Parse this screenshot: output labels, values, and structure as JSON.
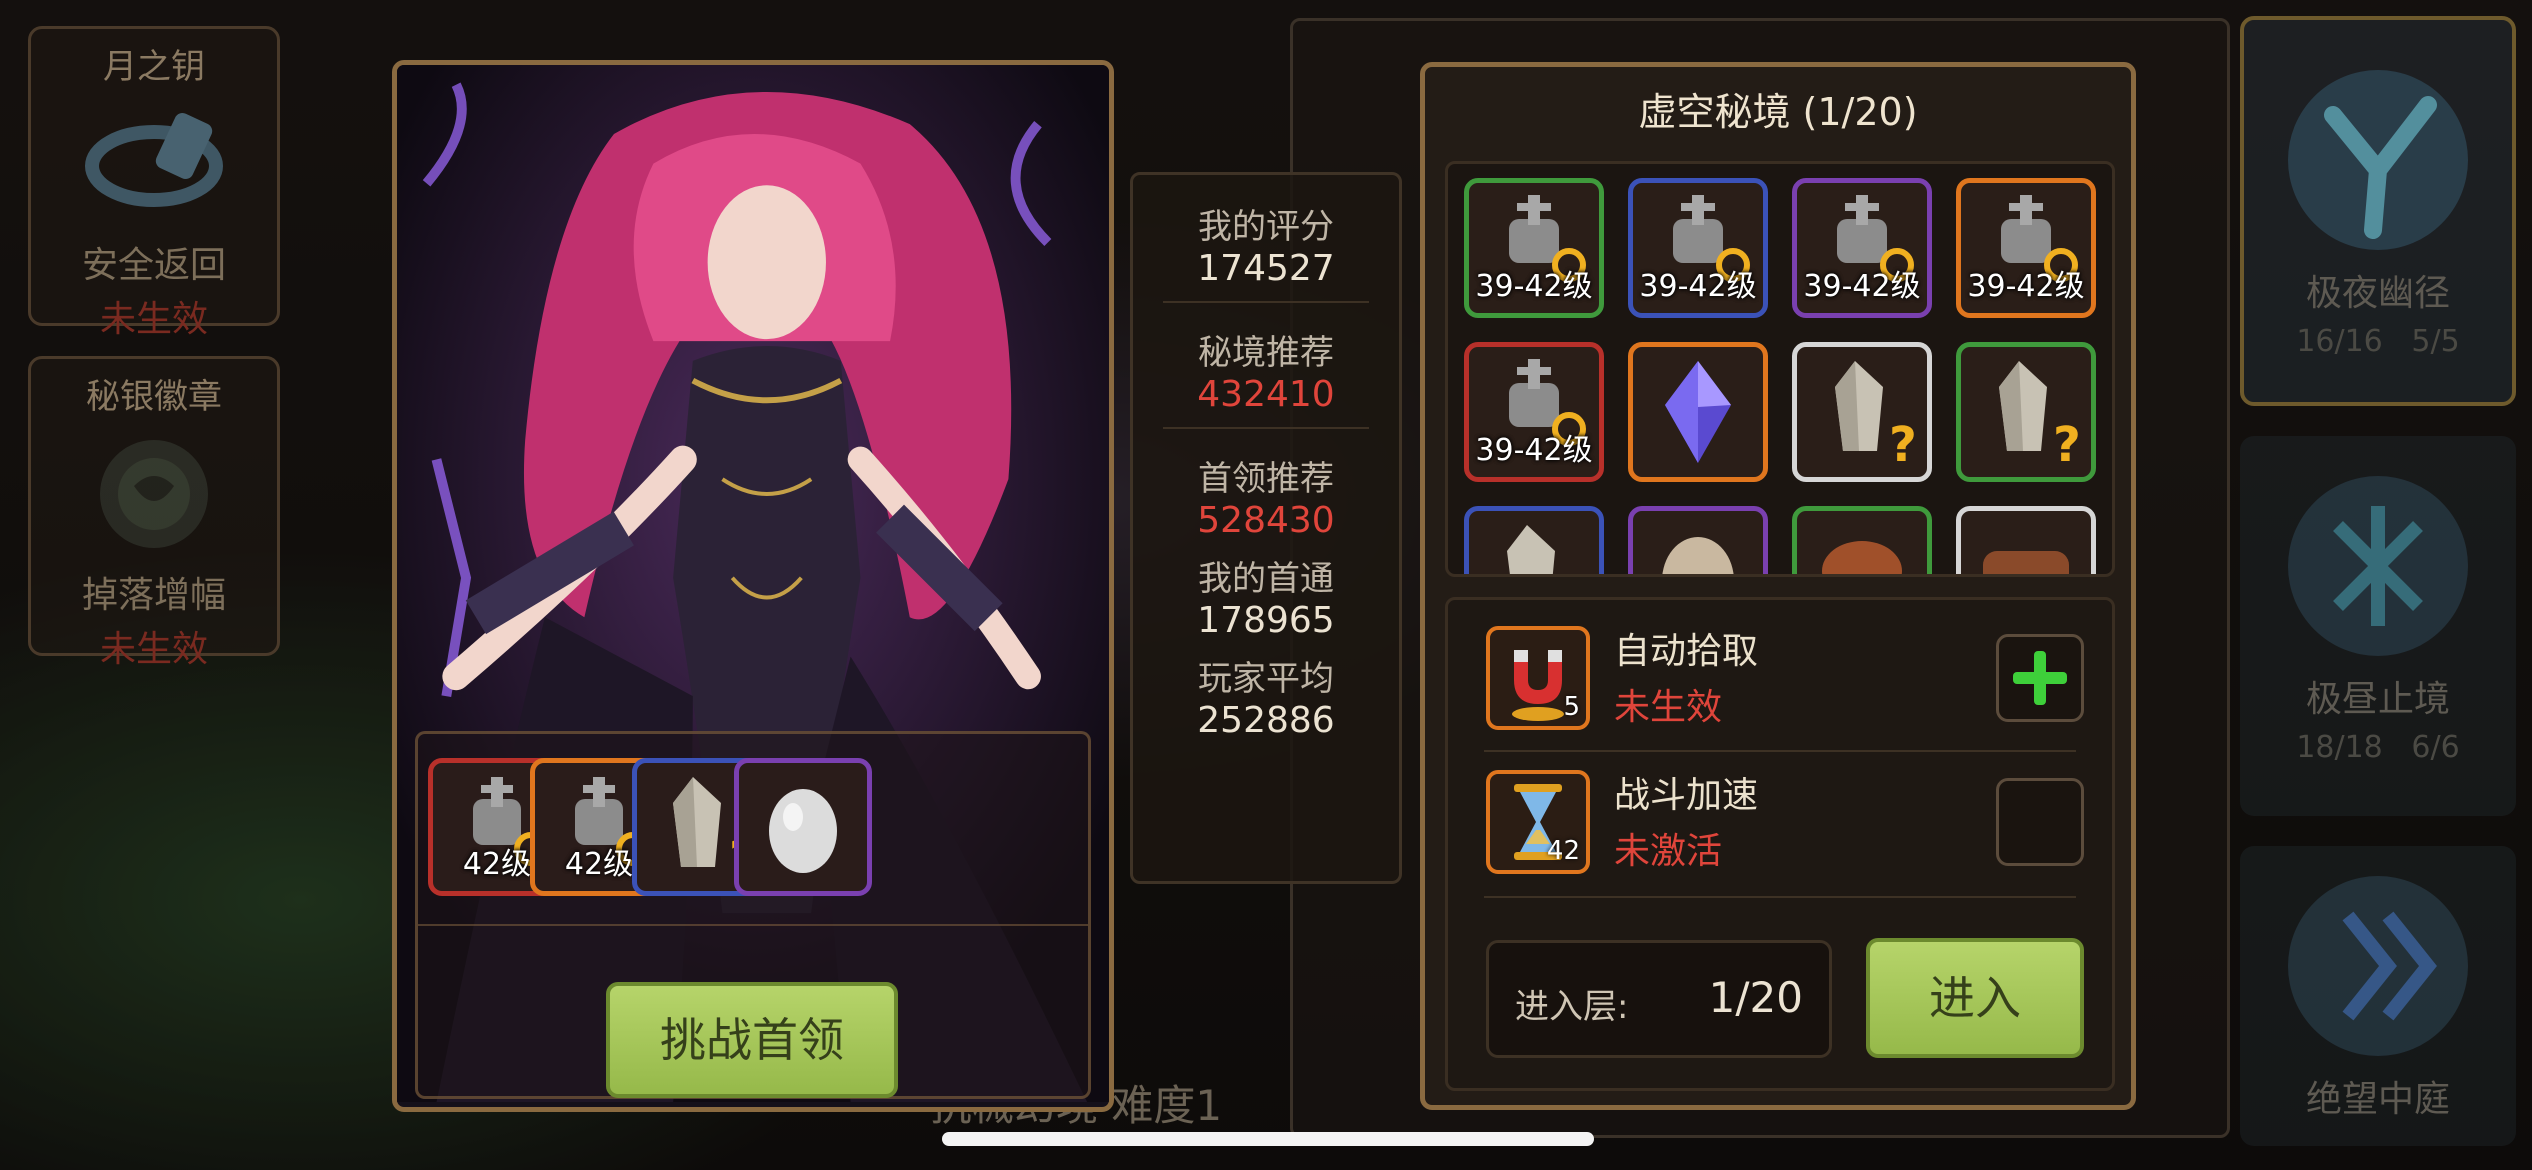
{
  "left_cards": [
    {
      "title": "月之钥",
      "label": "安全返回",
      "status": "未生效"
    },
    {
      "title": "秘银徽章",
      "label": "掉落增幅",
      "status": "未生效"
    }
  ],
  "right_cards": [
    {
      "name": "极夜幽径",
      "stat1": "16/16",
      "stat2": "5/5"
    },
    {
      "name": "极昼止境",
      "stat1": "18/18",
      "stat2": "6/6"
    },
    {
      "name": "绝望中庭",
      "stat1": "",
      "stat2": ""
    }
  ],
  "behind_text": "抗械幻境  难度1",
  "boss_panel": {
    "rewards": [
      {
        "label": "42级",
        "rarity": "red",
        "icon": "armor-helmet-icon"
      },
      {
        "label": "42级",
        "rarity": "orange",
        "icon": "armor-helmet-icon"
      },
      {
        "label": "",
        "rarity": "blue",
        "icon": "crystal-question-icon"
      },
      {
        "label": "",
        "rarity": "purple",
        "icon": "egg-icon"
      }
    ],
    "challenge_label": "挑战首领"
  },
  "stats": {
    "my_score_label": "我的评分",
    "my_score": "174527",
    "realm_rec_label": "秘境推荐",
    "realm_rec": "432410",
    "boss_rec_label": "首领推荐",
    "boss_rec": "528430",
    "my_first_label": "我的首通",
    "my_first": "178965",
    "avg_label": "玩家平均",
    "avg": "252886"
  },
  "dungeon": {
    "title": "虚空秘境 (1/20)",
    "grid": [
      {
        "label": "39-42级",
        "rarity": "green",
        "icon": "armor-helmet-icon"
      },
      {
        "label": "39-42级",
        "rarity": "blue",
        "icon": "armor-helmet-icon"
      },
      {
        "label": "39-42级",
        "rarity": "purple",
        "icon": "armor-helmet-icon"
      },
      {
        "label": "39-42级",
        "rarity": "orange",
        "icon": "armor-helmet-icon"
      },
      {
        "label": "39-42级",
        "rarity": "red",
        "icon": "armor-helmet-icon"
      },
      {
        "label": "",
        "rarity": "orange",
        "icon": "purple-gem-icon"
      },
      {
        "label": "",
        "rarity": "white",
        "icon": "crystal-question-icon"
      },
      {
        "label": "",
        "rarity": "green",
        "icon": "crystal-question-icon"
      },
      {
        "label": "",
        "rarity": "blue",
        "icon": "crystal-question-icon"
      },
      {
        "label": "",
        "rarity": "purple",
        "icon": "egg-icon"
      },
      {
        "label": "",
        "rarity": "green",
        "icon": "meat-icon"
      },
      {
        "label": "",
        "rarity": "white",
        "icon": "wood-log-icon"
      }
    ],
    "auto_pickup": {
      "title": "自动拾取",
      "status": "未生效",
      "count": "5"
    },
    "battle_speed": {
      "title": "战斗加速",
      "status": "未激活",
      "count": "42"
    },
    "floor_label": "进入层:",
    "floor_value": "1/20",
    "enter_label": "进入"
  }
}
